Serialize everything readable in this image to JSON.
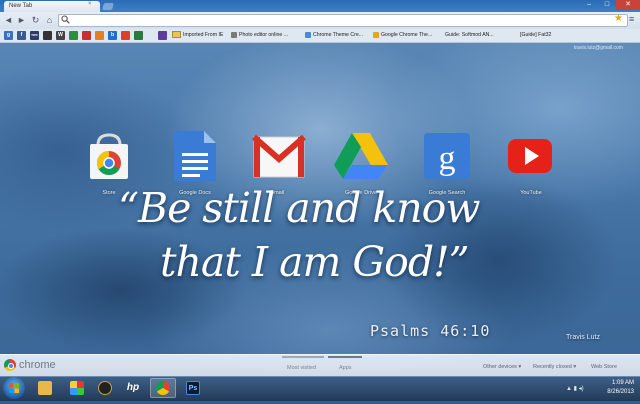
{
  "window": {
    "tab_title": "New Tab",
    "tab_close": "×",
    "controls": {
      "minimize": "–",
      "maximize": "□",
      "close": "✕"
    }
  },
  "toolbar": {
    "back": "◄",
    "forward": "►",
    "reload": "↻",
    "home": "⌂",
    "address_value": "",
    "star_icon": "★",
    "wrench_icon": "≡"
  },
  "bookmarks": {
    "icons": [
      {
        "glyph": "g",
        "color": "#3b6fc4"
      },
      {
        "glyph": "f",
        "color": "#3b5998"
      },
      {
        "glyph": "TWC",
        "color": "#2c3e66"
      },
      {
        "glyph": "",
        "color": "#333333"
      },
      {
        "glyph": "W",
        "color": "#444444"
      },
      {
        "glyph": "",
        "color": "#2d8e3b"
      },
      {
        "glyph": "",
        "color": "#c9302c"
      },
      {
        "glyph": "",
        "color": "#e67e22"
      },
      {
        "glyph": "b",
        "color": "#1e6fd0"
      },
      {
        "glyph": "",
        "color": "#e33b2e"
      },
      {
        "glyph": "",
        "color": "#2a7a3d"
      },
      {
        "glyph": "",
        "color": "#5f3b9c"
      }
    ],
    "items": [
      "Imported From IE",
      "Photo editor online ...",
      "Chrome Theme Cre...",
      "Google Chrome The...",
      "Guide: Softmod AN...",
      "[Guide] Fat32"
    ]
  },
  "user_email": "travis.lutz@gmail.com",
  "apps": [
    {
      "name": "Store",
      "icon": "store-icon"
    },
    {
      "name": "Google Docs",
      "icon": "docs-icon"
    },
    {
      "name": "Gmail",
      "icon": "gmail-icon"
    },
    {
      "name": "Google Drive",
      "icon": "drive-icon"
    },
    {
      "name": "Google Search",
      "icon": "search-icon"
    },
    {
      "name": "YouTube",
      "icon": "youtube-icon"
    }
  ],
  "quote": {
    "line1": "“Be still and know",
    "line2": "that I am God!”",
    "reference": "Psalms 46:10",
    "author": "Travis Lutz"
  },
  "ntp": {
    "brand": "chrome",
    "tab_most_visited": "Most visited",
    "tab_apps": "Apps",
    "other_devices": "Other devices ▾",
    "recently_closed": "Recently closed ▾",
    "web_store": "Web Store"
  },
  "taskbar": {
    "time": "1:09 AM",
    "date": "8/26/2013",
    "tray_icons": "▲ ▮ ◂)"
  },
  "colors": {
    "accent_blue": "#2b6cb5",
    "gmail_red": "#d93025",
    "youtube_red": "#e62117",
    "search_blue": "#3a7bd5"
  }
}
